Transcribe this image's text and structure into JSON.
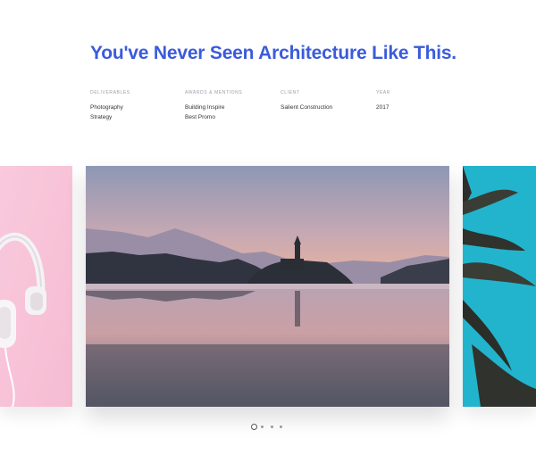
{
  "hero": {
    "title": "You've Never Seen Architecture Like This."
  },
  "meta": [
    {
      "label": "DELIVERABLES",
      "values": [
        "Photography",
        "Strategy"
      ]
    },
    {
      "label": "AWARDS & MENTIONS",
      "values": [
        "Building Inspire",
        "Best Promo"
      ]
    },
    {
      "label": "CLIENT",
      "values": [
        "Salient Construction"
      ]
    },
    {
      "label": "YEAR",
      "values": [
        "2017"
      ]
    }
  ],
  "carousel": {
    "slides": [
      "pink-headphones-image",
      "lake-church-image",
      "palm-tree-image"
    ],
    "active_slide": 2,
    "dot_count": 4,
    "active_dot": 1
  },
  "colors": {
    "accent": "#3b5bdb",
    "meta_label": "#9aa0a6",
    "text": "#333333"
  }
}
